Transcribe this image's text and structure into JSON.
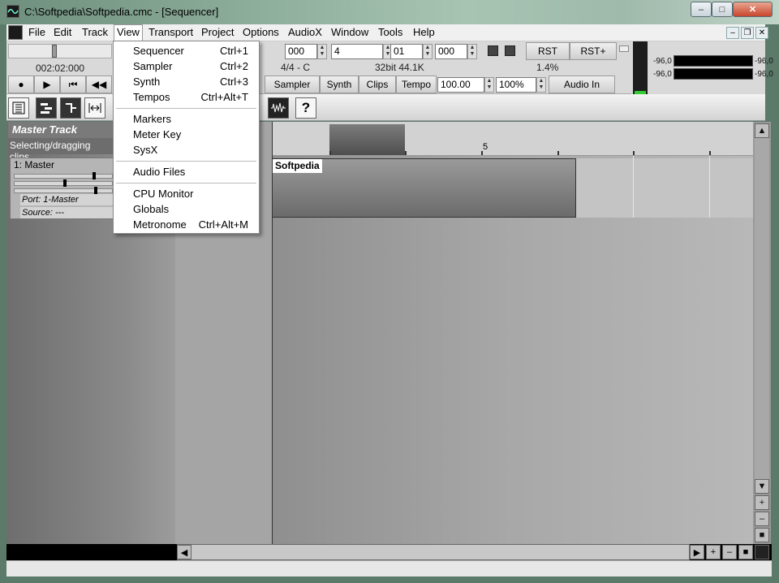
{
  "window": {
    "title": "C:\\Softpedia\\Softpedia.cmc - [Sequencer]",
    "minimize": "–",
    "maximize": "□",
    "close": "✕"
  },
  "menubar": {
    "items": [
      "File",
      "Edit",
      "Track",
      "View",
      "Transport",
      "Project",
      "Options",
      "AudioX",
      "Window",
      "Tools",
      "Help"
    ],
    "active": "View",
    "mdi_min": "–",
    "mdi_restore": "❐",
    "mdi_close": "✕"
  },
  "view_menu": {
    "items": [
      {
        "label": "Sequencer",
        "shortcut": "Ctrl+1"
      },
      {
        "label": "Sampler",
        "shortcut": "Ctrl+2"
      },
      {
        "label": "Synth",
        "shortcut": "Ctrl+3"
      },
      {
        "label": "Tempos",
        "shortcut": "Ctrl+Alt+T"
      },
      {
        "label": "Markers",
        "shortcut": ""
      },
      {
        "label": "Meter Key",
        "shortcut": ""
      },
      {
        "label": "SysX",
        "shortcut": ""
      },
      {
        "label": "Audio Files",
        "shortcut": ""
      },
      {
        "label": "CPU Monitor",
        "shortcut": ""
      },
      {
        "label": "Globals",
        "shortcut": ""
      },
      {
        "label": "Metronome",
        "shortcut": "Ctrl+Alt+M"
      }
    ]
  },
  "transport": {
    "time_display": "002:02:000",
    "field_ticks": "000",
    "field_beat": "4",
    "field_sub": "01",
    "field_frac": "000",
    "meter": "4/4 - C",
    "format": "32bit 44.1K",
    "cpu": "1.4%",
    "rst": "RST",
    "rst_plus": "RST+",
    "sampler": "Sampler",
    "synth": "Synth",
    "clips": "Clips",
    "tempo_label": "Tempo",
    "tempo_value": "100.00",
    "zoom": "100%",
    "audio_in": "Audio In",
    "btn_record": "●",
    "btn_play": "▶",
    "btn_start": "⏮",
    "btn_rewind": "◀◀"
  },
  "meters": {
    "left_in": "-96,0",
    "left_out": "-96,0",
    "right_in": "-96,0",
    "right_out": "-96,0"
  },
  "toolbar": {
    "help": "?"
  },
  "track_panel": {
    "header": "Master Track",
    "hint": "Selecting/dragging clips",
    "track_name": "1: Master",
    "port": "Port: 1-Master",
    "source": "Source: ---"
  },
  "timeline": {
    "ruler_marker": "5",
    "clip_name": "Softpedia"
  },
  "scrollbars": {
    "up": "▲",
    "down": "▼",
    "plus": "+",
    "minus": "–",
    "stop": "■",
    "left": "◀",
    "right": "▶"
  }
}
